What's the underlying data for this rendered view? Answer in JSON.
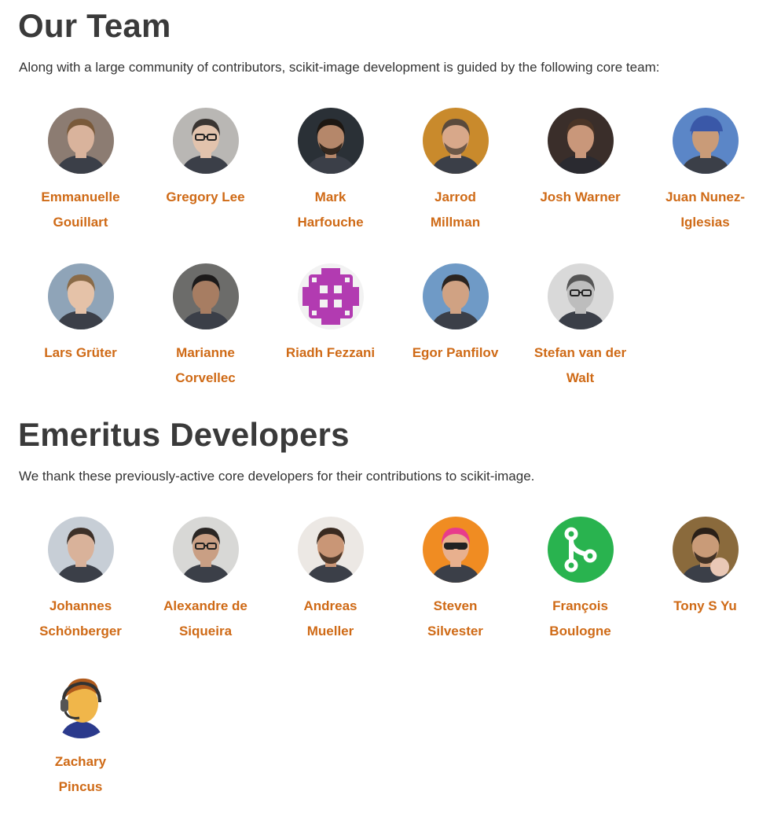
{
  "team": {
    "heading": "Our Team",
    "intro": "Along with a large community of contributors, scikit-image development is guided by the following core team:",
    "members": [
      {
        "name": "Emmanuelle Gouillart",
        "avatar": "photo-woman-icon",
        "bg": "#8c7c72",
        "skin": "#d9b39c",
        "hair": "#7a5a3a"
      },
      {
        "name": "Gregory Lee",
        "avatar": "photo-man-glasses-icon",
        "bg": "#b9b7b4",
        "skin": "#e2c3ad",
        "hair": "#3a3532"
      },
      {
        "name": "Mark Harfouche",
        "avatar": "photo-man-curly-icon",
        "bg": "#2a3036",
        "skin": "#b5876a",
        "hair": "#1d1712"
      },
      {
        "name": "Jarrod Millman",
        "avatar": "photo-man-forest-icon",
        "bg": "#c98a2c",
        "skin": "#d8a88a",
        "hair": "#5a4a3c"
      },
      {
        "name": "Josh Warner",
        "avatar": "photo-man-suit-icon",
        "bg": "#3a2e2a",
        "skin": "#c9977a",
        "hair": "#4a3426"
      },
      {
        "name": "Juan Nunez-Iglesias",
        "avatar": "photo-man-cap-icon",
        "bg": "#5b86c7",
        "skin": "#c99b78",
        "hair": "#3a58a8"
      },
      {
        "name": "Lars Grüter",
        "avatar": "photo-man-blond-icon",
        "bg": "#8fa4b8",
        "skin": "#e5c2a8",
        "hair": "#8a6b48"
      },
      {
        "name": "Marianne Corvellec",
        "avatar": "photo-woman-climbing-icon",
        "bg": "#6c6c6a",
        "skin": "#a77d62",
        "hair": "#1c1a1a"
      },
      {
        "name": "Riadh Fezzani",
        "avatar": "identicon-icon",
        "bg": "#f2f2f2",
        "skin": "#b23bb1",
        "hair": "#b23bb1"
      },
      {
        "name": "Egor Panfilov",
        "avatar": "photo-man-outdoor-icon",
        "bg": "#6f9ac6",
        "skin": "#d0a283",
        "hair": "#2b2420"
      },
      {
        "name": "Stefan van der Walt",
        "avatar": "photo-man-bw-icon",
        "bg": "#d9d9d9",
        "skin": "#bdbdbd",
        "hair": "#555555"
      }
    ]
  },
  "emeritus": {
    "heading": "Emeritus Developers",
    "intro": "We thank these previously-active core developers for their contributions to scikit-image.",
    "members": [
      {
        "name": "Johannes Schönberger",
        "avatar": "photo-man-winter-icon",
        "bg": "#c7ced6",
        "skin": "#d9b29a",
        "hair": "#3d3028"
      },
      {
        "name": "Alexandre de Siqueira",
        "avatar": "photo-man-glasses-icon",
        "bg": "#d8d8d6",
        "skin": "#c99f84",
        "hair": "#2a2624"
      },
      {
        "name": "Andreas Mueller",
        "avatar": "photo-man-beard-icon",
        "bg": "#ece8e4",
        "skin": "#c99676",
        "hair": "#3a2a20"
      },
      {
        "name": "Steven Silvester",
        "avatar": "photo-man-sunglasses-icon",
        "bg": "#f08c22",
        "skin": "#e8b08e",
        "hair": "#e83c8c"
      },
      {
        "name": "François Boulogne",
        "avatar": "git-branch-icon",
        "bg": "#29b34f",
        "skin": "#ffffff",
        "hair": "#ffffff"
      },
      {
        "name": "Tony S Yu",
        "avatar": "photo-man-baby-icon",
        "bg": "#8a6a3c",
        "skin": "#c99b78",
        "hair": "#2a2018"
      },
      {
        "name": "Zachary Pincus",
        "avatar": "cartoon-headset-icon",
        "bg": "#ffffff",
        "skin": "#f0b64a",
        "hair": "#b05a1c"
      }
    ]
  }
}
